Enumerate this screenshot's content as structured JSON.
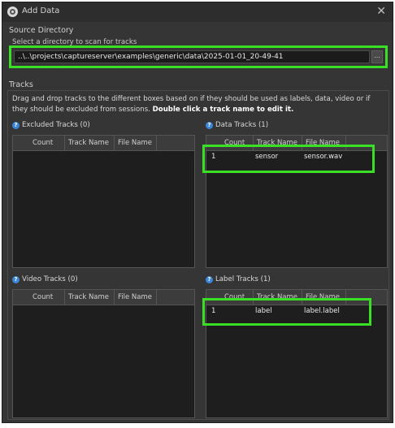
{
  "window": {
    "title": "Add Data",
    "close_symbol": "✕"
  },
  "source": {
    "section_label": "Source Directory",
    "field_label": "Select a directory to scan for tracks",
    "path_value": "..\\..\\projects\\captureserver\\examples\\generic\\data\\2025-01-01_20-49-41",
    "browse_label": "..."
  },
  "tracks": {
    "section_label": "Tracks",
    "instructions": "Drag and drop tracks to the different boxes based on if they should be used as labels, data, video or if they should be excluded from sessions.",
    "instructions_bold": "Double click a track name to edit it.",
    "help_symbol": "?",
    "columns": [
      "Count",
      "Track Name",
      "File Name"
    ],
    "excluded": {
      "label": "Excluded Tracks (0)",
      "rows": []
    },
    "data": {
      "label": "Data Tracks (1)",
      "rows": [
        {
          "count": "1",
          "track_name": "sensor",
          "file_name": "sensor.wav"
        }
      ]
    },
    "video": {
      "label": "Video Tracks (0)",
      "rows": []
    },
    "label_tracks": {
      "label": "Label Tracks (1)",
      "rows": [
        {
          "count": "1",
          "track_name": "label",
          "file_name": "label.label"
        }
      ]
    }
  },
  "colors": {
    "highlight": "#39e026",
    "help_icon": "#3b86d6",
    "window_bg": "#353535"
  }
}
